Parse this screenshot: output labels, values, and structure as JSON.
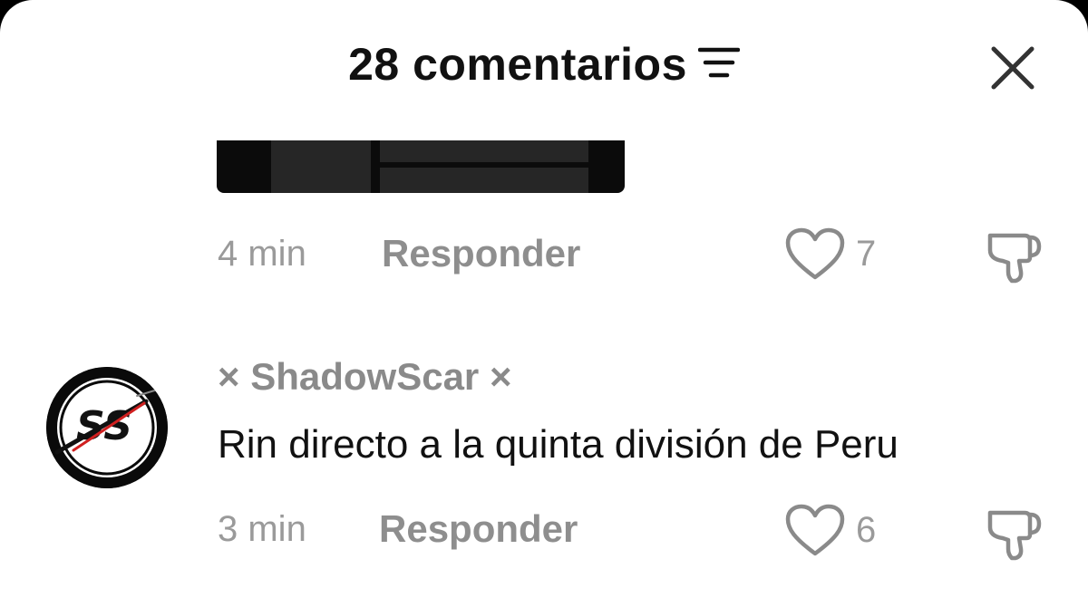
{
  "header": {
    "title": "28 comentarios",
    "filter_icon": "sort-filter-icon",
    "close_icon": "close-icon"
  },
  "comments": [
    {
      "time": "4 min",
      "reply_label": "Responder",
      "likes": "7",
      "has_media": true
    },
    {
      "username": "× ShadowScar ×",
      "avatar_icon": "ss-logo-avatar",
      "text": "Rin directo a la quinta división de Peru",
      "time": "3 min",
      "reply_label": "Responder",
      "likes": "6"
    }
  ],
  "colors": {
    "background": "#ffffff",
    "primary_text": "#111111",
    "secondary_text": "#9a9a9a",
    "icon": "#8a8a8a"
  }
}
